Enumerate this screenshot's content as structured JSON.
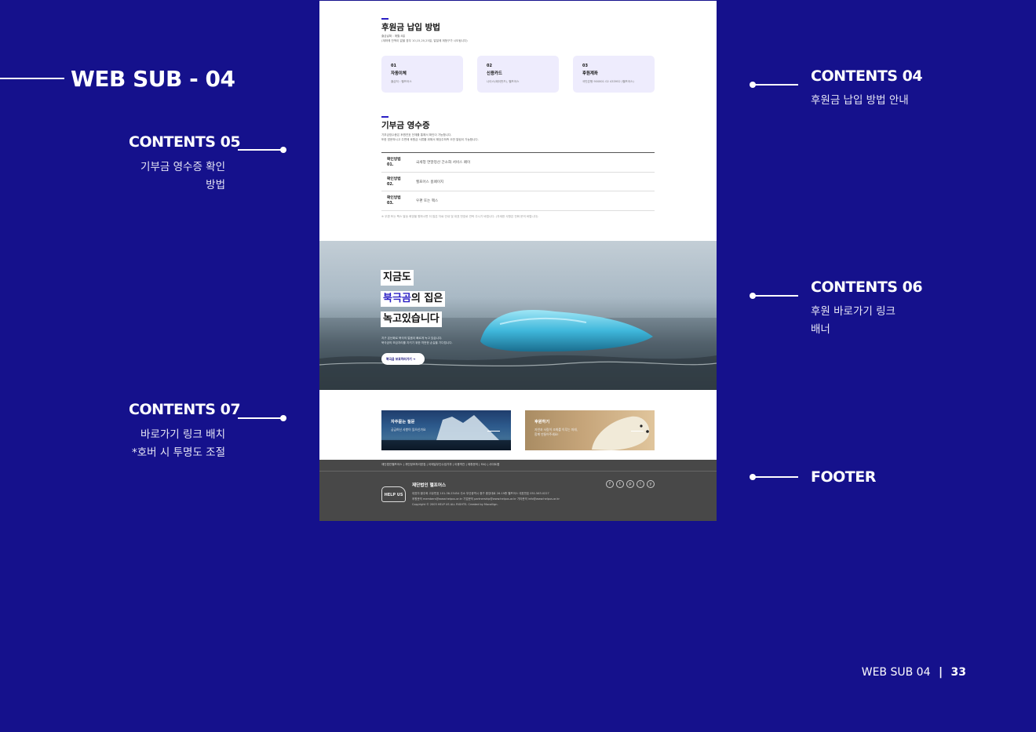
{
  "page_heading": "WEB SUB - 04",
  "annotations": [
    {
      "id": "c04",
      "label": "CONTENTS 04",
      "desc": "후원금 납입 방법 안내"
    },
    {
      "id": "c05",
      "label": "CONTENTS 05",
      "desc_lines": [
        "기부금 영수증 확인",
        "방법"
      ]
    },
    {
      "id": "c06",
      "label": "CONTENTS 06",
      "desc_lines": [
        "후원 바로가기 링크",
        "배너"
      ]
    },
    {
      "id": "c07",
      "label": "CONTENTS 07",
      "desc_lines": [
        "바로가기 링크 배치",
        "*호버 시 투명도 조절"
      ]
    },
    {
      "id": "footer",
      "label": "FOOTER"
    }
  ],
  "payment": {
    "title": "후원금 납입 방법",
    "note1": "출금날짜 : 매월 8일",
    "note2": "(계좌에 잔액이 없을 경우 10,15,20,25일, 말일에 재청구가 시도됩니다)",
    "cards": [
      {
        "num": "01",
        "title": "자동이체",
        "sub": "출금처 : 헬프어스"
      },
      {
        "num": "02",
        "title": "신용카드",
        "sub": "나이스(페이먼츠), 헬프어스"
      },
      {
        "num": "03",
        "title": "후원계좌",
        "sub": "국민은행 900801 02 433952 (헬프어스)"
      }
    ]
  },
  "receipt": {
    "title": "기부금 영수증",
    "desc1": "기부금영수증은 후원연호 전체를 통해서 확인이 가능합니다.",
    "desc2": "또한 방문하시고 주변에 후원금 서류를 위해서 해당주최측 오반 알림이 가능합니다.",
    "rows": [
      {
        "k1": "확인방법",
        "k2": "01.",
        "v": "국세청 연말정산 간소화 서비스 페이"
      },
      {
        "k1": "확인방법",
        "k2": "02.",
        "v": "헬프어스 홈페이지"
      },
      {
        "k1": "확인방법",
        "k2": "03.",
        "v": "우편 또는 팩스"
      }
    ],
    "footnote": "※ 우편 또는 팩스 발송 희망을 원하시면 더 많은 자료 안내 및 대표 번호로 연락 주시기 바랍니다. (자세한 사항은 전화 문의 바랍니다)"
  },
  "banner": {
    "line1": "지금도",
    "line2_hl": "북극곰",
    "line2_rest": "의 집은",
    "line3": "녹고있습니다",
    "sub1": "지구 온난화로 북극의 얼음이 빠르게 녹고 있습니다.",
    "sub2": "북극곰의 보금자리를 지키기 위한 따뜻한 손길을 기다립니다.",
    "button": "북극곰 보호하러가기 ➔"
  },
  "links": [
    {
      "title": "자주묻는 질문",
      "sub": "궁금하신 사항이 있으신가요"
    },
    {
      "title": "후원하기",
      "sub1": "자연과 사람이 조화를 이루는 미래,",
      "sub2": "함께 만들어주세요!"
    }
  ],
  "footer": {
    "nav": "재단법인헬프어스  |  개인정보처리방침  |  이메일무단수집거부  |  이용약관  |  제휴문의  |  FAQ  |  사이트맵",
    "name": "재단법인 헬프어스",
    "info1": "대표자 황주희     고유번호 101-36-23454     주소 부산광역시 중구 중앙대로 26-19층 헬프어스     대표번호 051.563.0227",
    "info2": "후원문의 members@www.helpus.or.kr     기업문의 partnership@www.helpus.or.kr     기타문의 info@www.helpus.or.kr",
    "copyright": "Copyright © 2003 HELP US ALL RIGHTS. Created by Mocollign.",
    "logo": "HELP US",
    "sns": [
      "f",
      "t",
      "p",
      "i",
      "y"
    ]
  },
  "pager": {
    "label": "WEB SUB 04",
    "sep": "|",
    "num": "33"
  },
  "colors": {
    "background": "#15118c",
    "accent": "#2a1fc4",
    "card_bg": "#eeecfd",
    "footer_bg": "#484848"
  }
}
